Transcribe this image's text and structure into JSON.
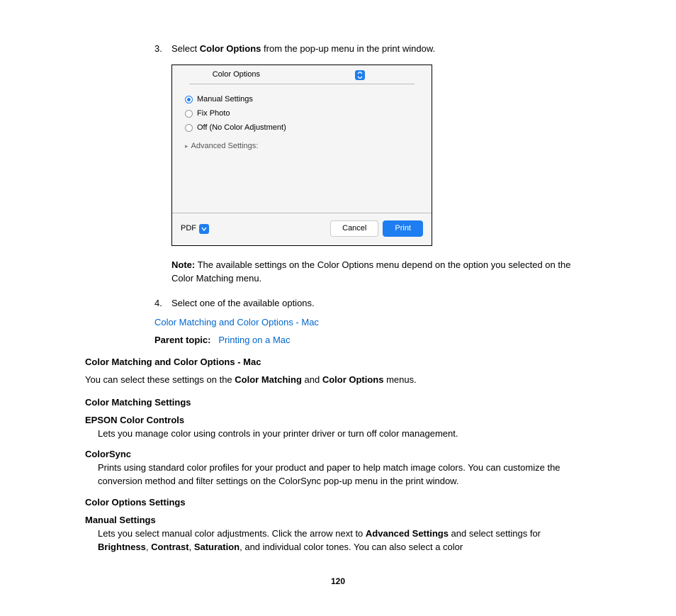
{
  "step3": {
    "num": "3.",
    "pre": "Select ",
    "bold": "Color Options",
    "post": " from the pop-up menu in the print window."
  },
  "dialog": {
    "popup": "Color Options",
    "radioManual": "Manual Settings",
    "radioFix": "Fix Photo",
    "radioOff": "Off (No Color Adjustment)",
    "advanced": "Advanced Settings:",
    "pdf": "PDF",
    "cancel": "Cancel",
    "print": "Print"
  },
  "note": {
    "label": "Note:",
    "text": " The available settings on the Color Options menu depend on the option you selected on the Color Matching menu."
  },
  "step4": {
    "num": "4.",
    "text": "Select one of the available options."
  },
  "link1": "Color Matching and Color Options - Mac",
  "parentLabel": "Parent topic:",
  "parentLink": "Printing on a Mac",
  "heading": "Color Matching and Color Options - Mac",
  "intro": {
    "pre": "You can select these settings on the ",
    "b1": "Color Matching",
    "mid": " and ",
    "b2": "Color Options",
    "post": " menus."
  },
  "cmSettingsHead": "Color Matching Settings",
  "epson": {
    "term": "EPSON Color Controls",
    "desc": "Lets you manage color using controls in your printer driver or turn off color management."
  },
  "colorsync": {
    "term": "ColorSync",
    "desc": "Prints using standard color profiles for your product and paper to help match image colors. You can customize the conversion method and filter settings on the ColorSync pop-up menu in the print window."
  },
  "coSettingsHead": "Color Options Settings",
  "manual": {
    "term": "Manual Settings",
    "d1": "Lets you select manual color adjustments. Click the arrow next to ",
    "d2": "Advanced Settings",
    "d3": " and select settings for ",
    "d4": "Brightness",
    "d5": ", ",
    "d6": "Contrast",
    "d7": ", ",
    "d8": "Saturation",
    "d9": ", and individual color tones. You can also select a color"
  },
  "pageNum": "120"
}
